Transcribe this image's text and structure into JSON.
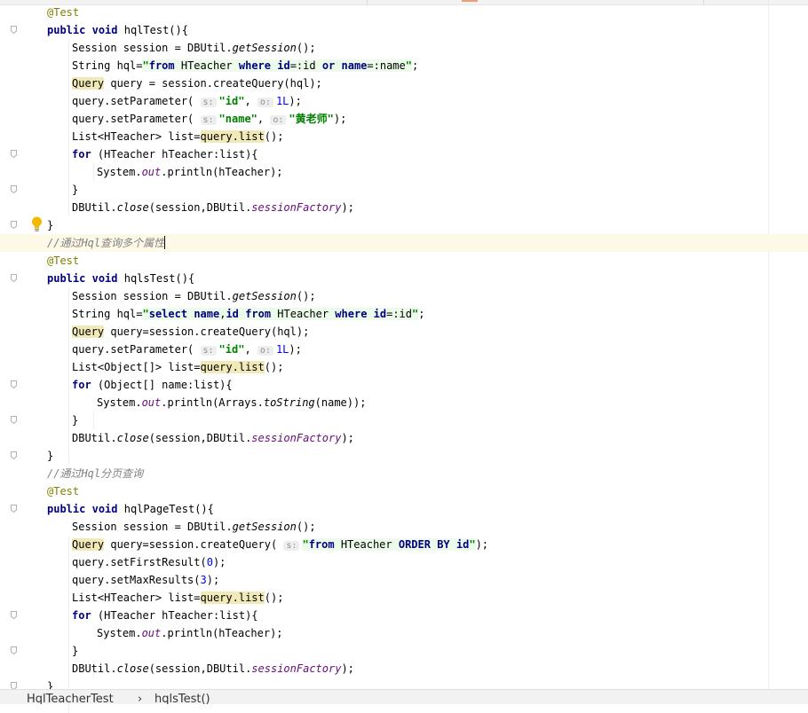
{
  "editor": {
    "lines": [
      {
        "fold": false,
        "indent": 1,
        "tokens": [
          {
            "t": "@Test",
            "c": "ann"
          }
        ]
      },
      {
        "fold": true,
        "indent": 1,
        "tokens": [
          {
            "t": "public",
            "c": "kw"
          },
          {
            "t": " "
          },
          {
            "t": "void",
            "c": "kw"
          },
          {
            "t": " hqlTest(){"
          }
        ]
      },
      {
        "fold": false,
        "indent": 2,
        "tokens": [
          {
            "t": "Session session = DBUtil."
          },
          {
            "t": "getSession",
            "c": "stc"
          },
          {
            "t": "();"
          }
        ]
      },
      {
        "fold": false,
        "indent": 2,
        "tokens": [
          {
            "t": "String hql="
          },
          {
            "t": "\"",
            "c": "str strbg"
          },
          {
            "t": "from",
            "c": "kw strbg"
          },
          {
            "t": " HTeacher ",
            "c": "strbg"
          },
          {
            "t": "where",
            "c": "kw strbg"
          },
          {
            "t": " ",
            "c": "strbg"
          },
          {
            "t": "id",
            "c": "kw strbg"
          },
          {
            "t": "=:id ",
            "c": "strbg"
          },
          {
            "t": "or",
            "c": "kw strbg"
          },
          {
            "t": " ",
            "c": "strbg"
          },
          {
            "t": "name",
            "c": "kw strbg"
          },
          {
            "t": "=:name",
            "c": "strbg"
          },
          {
            "t": "\"",
            "c": "str strbg"
          },
          {
            "t": ";"
          }
        ]
      },
      {
        "fold": false,
        "indent": 2,
        "tokens": [
          {
            "t": "Query",
            "c": "hl"
          },
          {
            "t": " query = session.createQuery(hql);"
          }
        ]
      },
      {
        "fold": false,
        "indent": 2,
        "tokens": [
          {
            "t": "query.setParameter( "
          },
          {
            "t": "s:",
            "c": "hint"
          },
          {
            "t": "\"id\"",
            "c": "str"
          },
          {
            "t": ", "
          },
          {
            "t": "o:",
            "c": "hint"
          },
          {
            "t": "1L",
            "c": "num"
          },
          {
            "t": ");"
          }
        ]
      },
      {
        "fold": false,
        "indent": 2,
        "tokens": [
          {
            "t": "query.setParameter( "
          },
          {
            "t": "s:",
            "c": "hint"
          },
          {
            "t": "\"name\"",
            "c": "str"
          },
          {
            "t": ", "
          },
          {
            "t": "o:",
            "c": "hint"
          },
          {
            "t": "\"黄老师\"",
            "c": "str"
          },
          {
            "t": ");"
          }
        ]
      },
      {
        "fold": false,
        "indent": 2,
        "tokens": [
          {
            "t": "List<HTeacher> list="
          },
          {
            "t": "query.list",
            "c": "hl"
          },
          {
            "t": "();"
          }
        ]
      },
      {
        "fold": true,
        "indent": 2,
        "tokens": [
          {
            "t": "for",
            "c": "kw"
          },
          {
            "t": " (HTeacher hTeacher:list){"
          }
        ]
      },
      {
        "fold": false,
        "indent": 3,
        "tokens": [
          {
            "t": "System."
          },
          {
            "t": "out",
            "c": "fld"
          },
          {
            "t": ".println(hTeacher);"
          }
        ]
      },
      {
        "fold": true,
        "indent": 2,
        "tokens": [
          {
            "t": "}"
          }
        ]
      },
      {
        "fold": false,
        "indent": 2,
        "tokens": [
          {
            "t": "DBUtil."
          },
          {
            "t": "close",
            "c": "stc"
          },
          {
            "t": "(session,DBUtil."
          },
          {
            "t": "sessionFactory",
            "c": "fld"
          },
          {
            "t": ");"
          }
        ]
      },
      {
        "fold": true,
        "indent": 1,
        "tokens": [
          {
            "t": "}"
          }
        ]
      },
      {
        "fold": false,
        "indent": 1,
        "current": true,
        "caret": true,
        "tokens": [
          {
            "t": "//通过Hql查询多个属性",
            "c": "cmt"
          }
        ]
      },
      {
        "fold": false,
        "indent": 1,
        "tokens": [
          {
            "t": "@Test",
            "c": "ann"
          }
        ]
      },
      {
        "fold": true,
        "indent": 1,
        "tokens": [
          {
            "t": "public",
            "c": "kw"
          },
          {
            "t": " "
          },
          {
            "t": "void",
            "c": "kw"
          },
          {
            "t": " hqlsTest(){"
          }
        ]
      },
      {
        "fold": false,
        "indent": 2,
        "tokens": [
          {
            "t": "Session session = DBUtil."
          },
          {
            "t": "getSession",
            "c": "stc"
          },
          {
            "t": "();"
          }
        ]
      },
      {
        "fold": false,
        "indent": 2,
        "tokens": [
          {
            "t": "String hql="
          },
          {
            "t": "\"",
            "c": "str strbg"
          },
          {
            "t": "select",
            "c": "kw strbg"
          },
          {
            "t": " ",
            "c": "strbg"
          },
          {
            "t": "name",
            "c": "kw strbg"
          },
          {
            "t": ",",
            "c": "strbg"
          },
          {
            "t": "id",
            "c": "kw strbg"
          },
          {
            "t": " ",
            "c": "strbg"
          },
          {
            "t": "from",
            "c": "kw strbg"
          },
          {
            "t": " HTeacher ",
            "c": "strbg"
          },
          {
            "t": "where",
            "c": "kw strbg"
          },
          {
            "t": " ",
            "c": "strbg"
          },
          {
            "t": "id",
            "c": "kw strbg"
          },
          {
            "t": "=:id",
            "c": "strbg"
          },
          {
            "t": "\"",
            "c": "str strbg"
          },
          {
            "t": ";"
          }
        ]
      },
      {
        "fold": false,
        "indent": 2,
        "tokens": [
          {
            "t": "Query",
            "c": "hl"
          },
          {
            "t": " query=session.createQuery(hql);"
          }
        ]
      },
      {
        "fold": false,
        "indent": 2,
        "tokens": [
          {
            "t": "query.setParameter( "
          },
          {
            "t": "s:",
            "c": "hint"
          },
          {
            "t": "\"id\"",
            "c": "str"
          },
          {
            "t": ", "
          },
          {
            "t": "o:",
            "c": "hint"
          },
          {
            "t": "1L",
            "c": "num"
          },
          {
            "t": ");"
          }
        ]
      },
      {
        "fold": false,
        "indent": 2,
        "tokens": [
          {
            "t": "List<Object[]> list="
          },
          {
            "t": "query.list",
            "c": "hl"
          },
          {
            "t": "();"
          }
        ]
      },
      {
        "fold": true,
        "indent": 2,
        "tokens": [
          {
            "t": "for",
            "c": "kw"
          },
          {
            "t": " (Object[] name:list){"
          }
        ]
      },
      {
        "fold": false,
        "indent": 3,
        "tokens": [
          {
            "t": "System."
          },
          {
            "t": "out",
            "c": "fld"
          },
          {
            "t": ".println(Arrays."
          },
          {
            "t": "toString",
            "c": "stc"
          },
          {
            "t": "(name));"
          }
        ]
      },
      {
        "fold": true,
        "indent": 2,
        "tokens": [
          {
            "t": "}"
          }
        ]
      },
      {
        "fold": false,
        "indent": 2,
        "tokens": [
          {
            "t": "DBUtil."
          },
          {
            "t": "close",
            "c": "stc"
          },
          {
            "t": "(session,DBUtil."
          },
          {
            "t": "sessionFactory",
            "c": "fld"
          },
          {
            "t": ");"
          }
        ]
      },
      {
        "fold": true,
        "indent": 1,
        "tokens": [
          {
            "t": "}"
          }
        ]
      },
      {
        "fold": false,
        "indent": 1,
        "tokens": [
          {
            "t": "//通过Hql分页查询",
            "c": "cmt"
          }
        ]
      },
      {
        "fold": false,
        "indent": 1,
        "tokens": [
          {
            "t": "@Test",
            "c": "ann"
          }
        ]
      },
      {
        "fold": true,
        "indent": 1,
        "tokens": [
          {
            "t": "public",
            "c": "kw"
          },
          {
            "t": " "
          },
          {
            "t": "void",
            "c": "kw"
          },
          {
            "t": " hqlPageTest(){"
          }
        ]
      },
      {
        "fold": false,
        "indent": 2,
        "tokens": [
          {
            "t": "Session session = DBUtil."
          },
          {
            "t": "getSession",
            "c": "stc"
          },
          {
            "t": "();"
          }
        ]
      },
      {
        "fold": false,
        "indent": 2,
        "tokens": [
          {
            "t": "Query",
            "c": "hl"
          },
          {
            "t": " query=session.createQuery( "
          },
          {
            "t": "s:",
            "c": "hint"
          },
          {
            "t": "\"",
            "c": "str strbg"
          },
          {
            "t": "from",
            "c": "kw strbg"
          },
          {
            "t": " HTeacher ",
            "c": "strbg"
          },
          {
            "t": "ORDER BY",
            "c": "kw strbg"
          },
          {
            "t": " ",
            "c": "strbg"
          },
          {
            "t": "id",
            "c": "kw strbg"
          },
          {
            "t": "\"",
            "c": "str strbg"
          },
          {
            "t": ");"
          }
        ]
      },
      {
        "fold": false,
        "indent": 2,
        "tokens": [
          {
            "t": "query.setFirstResult("
          },
          {
            "t": "0",
            "c": "num"
          },
          {
            "t": ");"
          }
        ]
      },
      {
        "fold": false,
        "indent": 2,
        "tokens": [
          {
            "t": "query.setMaxResults("
          },
          {
            "t": "3",
            "c": "num"
          },
          {
            "t": ");"
          }
        ]
      },
      {
        "fold": false,
        "indent": 2,
        "tokens": [
          {
            "t": "List<HTeacher> list="
          },
          {
            "t": "query.list",
            "c": "hl"
          },
          {
            "t": "();"
          }
        ]
      },
      {
        "fold": true,
        "indent": 2,
        "tokens": [
          {
            "t": "for",
            "c": "kw"
          },
          {
            "t": " (HTeacher hTeacher:list){"
          }
        ]
      },
      {
        "fold": false,
        "indent": 3,
        "tokens": [
          {
            "t": "System."
          },
          {
            "t": "out",
            "c": "fld"
          },
          {
            "t": ".println(hTeacher);"
          }
        ]
      },
      {
        "fold": true,
        "indent": 2,
        "tokens": [
          {
            "t": "}"
          }
        ]
      },
      {
        "fold": false,
        "indent": 2,
        "tokens": [
          {
            "t": "DBUtil."
          },
          {
            "t": "close",
            "c": "stc"
          },
          {
            "t": "(session,DBUtil."
          },
          {
            "t": "sessionFactory",
            "c": "fld"
          },
          {
            "t": ");"
          }
        ]
      },
      {
        "fold": true,
        "indent": 1,
        "tokens": [
          {
            "t": "}"
          }
        ]
      }
    ],
    "intention_bulb_icon": "lightbulb-icon",
    "fold_marker_icon": "fold-marker-icon"
  },
  "breadcrumb": {
    "class_name": "HqlTeacherTest",
    "separator": "›",
    "method_name": "hqlsTest()"
  },
  "colors": {
    "keyword": "#000080",
    "string": "#008000",
    "annotation": "#808000",
    "comment": "#808080",
    "number": "#0000ff",
    "field": "#660e7a",
    "usage_highlight": "#f2e9b8",
    "current_line": "#fcf9e7"
  }
}
